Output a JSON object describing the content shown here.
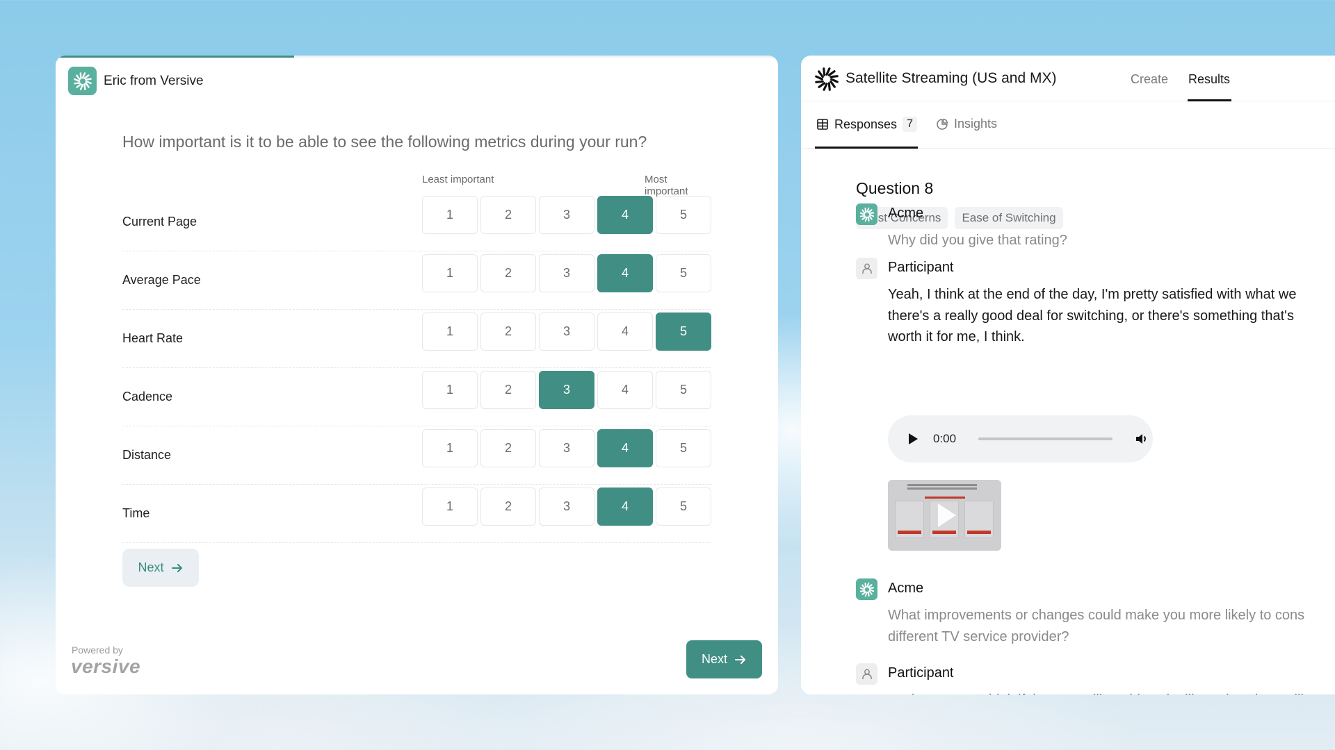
{
  "survey": {
    "progress_percent": 33,
    "sender": "Eric from Versive",
    "question": "How important is it to be able to see the following metrics during your run?",
    "scale_min_label": "Least important",
    "scale_max_label": "Most important",
    "options": [
      "1",
      "2",
      "3",
      "4",
      "5"
    ],
    "rows": [
      {
        "label": "Current Page",
        "selected": 4
      },
      {
        "label": "Average Pace",
        "selected": 4
      },
      {
        "label": "Heart Rate",
        "selected": 5
      },
      {
        "label": "Cadence",
        "selected": 3
      },
      {
        "label": "Distance",
        "selected": 4
      },
      {
        "label": "Time",
        "selected": 4
      }
    ],
    "inline_next_label": "Next",
    "primary_next_label": "Next",
    "powered_by": "Powered by",
    "brand_wordmark": "versive"
  },
  "results": {
    "title": "Satellite Streaming (US and MX)",
    "top_tabs": [
      {
        "label": "Create",
        "active": false
      },
      {
        "label": "Results",
        "active": true
      }
    ],
    "sub_tabs": {
      "responses_label": "Responses",
      "responses_count": "7",
      "insights_label": "Insights"
    },
    "question_title": "Question 8",
    "tags": [
      "Cost Concerns",
      "Ease of Switching"
    ],
    "messages": [
      {
        "speaker": "Acme",
        "role": "bot",
        "lines": [
          "Why did you give that rating?"
        ]
      },
      {
        "speaker": "Participant",
        "role": "user",
        "lines": [
          "Yeah, I think at the end of the day, I'm pretty satisfied with what we",
          "there's a really good deal for switching, or there's something that's",
          "worth it for me, I think."
        ]
      },
      {
        "speaker": "Acme",
        "role": "bot",
        "lines": [
          "What improvements or changes could make you more likely to cons",
          "different TV service provider?"
        ]
      },
      {
        "speaker": "Participant",
        "role": "user",
        "lines": [
          "Yeah, I mean, I think if there was like a big sale, like, I don't know, lik"
        ]
      }
    ],
    "audio": {
      "time": "0:00",
      "played_fraction": 0
    },
    "video_thumbnail": {
      "icon": "play-icon"
    }
  },
  "colors": {
    "accent": "#418f84",
    "logo_bg": "#5ab09f",
    "inline_button_bg": "#e9eff2"
  }
}
